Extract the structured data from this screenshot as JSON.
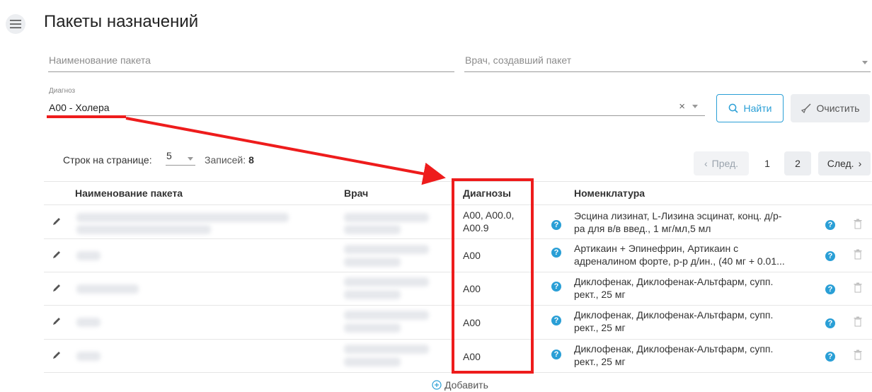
{
  "header": {
    "title": "Пакеты назначений"
  },
  "filters": {
    "package_name_placeholder": "Наименование пакета",
    "doctor_placeholder": "Врач, создавший пакет",
    "diagnosis_label": "Диагноз",
    "diagnosis_value": "A00 - Холера",
    "clear_symbol": "×",
    "find_label": "Найти",
    "clear_label": "Очистить"
  },
  "paging": {
    "rows_label": "Строк на странице:",
    "rows_value": "5",
    "records_label": "Записей:",
    "records_value": "8",
    "prev_label": "Пред.",
    "pages": [
      "1",
      "2"
    ],
    "next_label": "След."
  },
  "table": {
    "headers": {
      "name": "Наименование пакета",
      "doctor": "Врач",
      "diagnoses": "Диагнозы",
      "nomenclature": "Номенклатура"
    },
    "rows": [
      {
        "diagnoses": [
          "A00, A00.0,",
          "A00.9"
        ],
        "nomenclature": [
          "Эсцина лизинат, L-Лизина эсцинат, конц. д/р-",
          "ра для в/в введ., 1 мг/мл,5 мл"
        ]
      },
      {
        "diagnoses": [
          "A00"
        ],
        "nomenclature": [
          "Артикаин + Эпинефрин, Артикаин с",
          "адреналином форте, р-р д/ин., (40 мг + 0.01..."
        ]
      },
      {
        "diagnoses": [
          "A00"
        ],
        "nomenclature": [
          "Диклофенак, Диклофенак-Альтфарм, супп.",
          "рект., 25 мг"
        ]
      },
      {
        "diagnoses": [
          "A00"
        ],
        "nomenclature": [
          "Диклофенак, Диклофенак-Альтфарм, супп.",
          "рект., 25 мг"
        ]
      },
      {
        "diagnoses": [
          "A00"
        ],
        "nomenclature": [
          "Диклофенак, Диклофенак-Альтфарм, супп.",
          "рект., 25 мг"
        ]
      }
    ]
  },
  "add_label": "Добавить",
  "colors": {
    "accent": "#2a9fd6",
    "annotation": "#ee1c1c"
  },
  "icons": [
    "hamburger-icon",
    "search-icon",
    "broom-icon",
    "pencil-icon",
    "help-icon",
    "trash-icon",
    "plus-circle-icon",
    "chevron-left-icon",
    "chevron-right-icon",
    "chevron-down-icon"
  ]
}
